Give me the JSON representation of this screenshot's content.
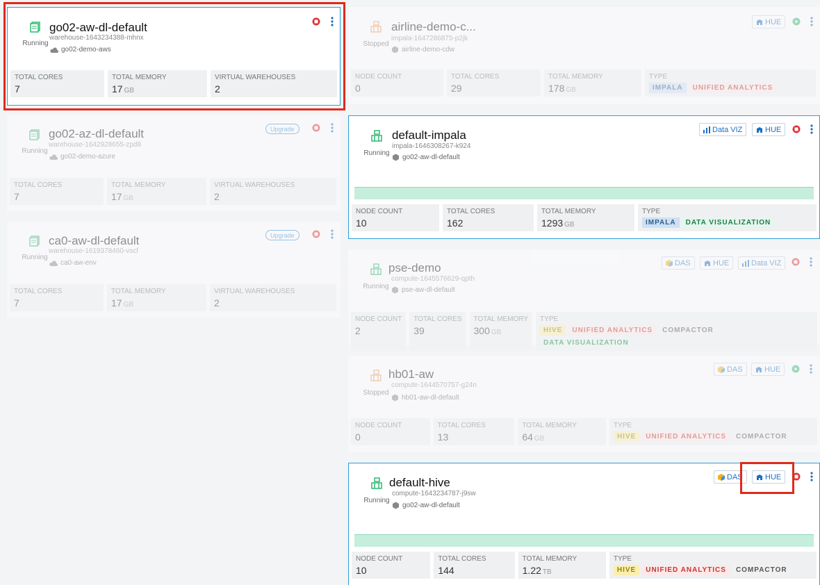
{
  "warehouses": [
    {
      "name": "go02-aw-dl-default",
      "id": "warehouse-1643234388-mhnx",
      "env": "go02-demo-aws",
      "status": "Running",
      "labels": {
        "cores": "TOTAL CORES",
        "memory": "TOTAL MEMORY",
        "vw": "VIRTUAL WAREHOUSES"
      },
      "cores": "7",
      "memory": "17",
      "memory_unit": "GB",
      "vws": "2"
    },
    {
      "name": "go02-az-dl-default",
      "id": "warehouse-1642928655-zpd8",
      "env": "go02-demo-azure",
      "status": "Running",
      "upgrade": "Upgrade",
      "labels": {
        "cores": "TOTAL CORES",
        "memory": "TOTAL MEMORY",
        "vw": "VIRTUAL WAREHOUSES"
      },
      "cores": "7",
      "memory": "17",
      "memory_unit": "GB",
      "vws": "2"
    },
    {
      "name": "ca0-aw-dl-default",
      "id": "warehouse-1619378460-vscf",
      "env": "ca0-aw-env",
      "status": "Running",
      "upgrade": "Upgrade",
      "labels": {
        "cores": "TOTAL CORES",
        "memory": "TOTAL MEMORY",
        "vw": "VIRTUAL WAREHOUSES"
      },
      "cores": "7",
      "memory": "17",
      "memory_unit": "GB",
      "vws": "2"
    }
  ],
  "vws": [
    {
      "name": "airline-demo-c...",
      "id": "impala-1647286875-p2jk",
      "env": "airline-demo-cdw",
      "status": "Stopped",
      "labels": {
        "nodes": "NODE COUNT",
        "cores": "TOTAL CORES",
        "memory": "TOTAL MEMORY",
        "type": "TYPE"
      },
      "nodes": "0",
      "cores": "29",
      "memory": "178",
      "memory_unit": "GB",
      "tags": [
        "IMPALA",
        "UNIFIED ANALYTICS"
      ],
      "hue": "HUE"
    },
    {
      "name": "default-impala",
      "id": "impala-1646308267-k924",
      "env": "go02-aw-dl-default",
      "status": "Running",
      "labels": {
        "nodes": "NODE COUNT",
        "cores": "TOTAL CORES",
        "memory": "TOTAL MEMORY",
        "type": "TYPE"
      },
      "nodes": "10",
      "cores": "162",
      "memory": "1293",
      "memory_unit": "GB",
      "tags": [
        "IMPALA",
        "DATA VISUALIZATION"
      ],
      "dataviz": "Data VIZ",
      "hue": "HUE"
    },
    {
      "name": "pse-demo",
      "id": "compute-1645576629-qpth",
      "env": "pse-aw-dl-default",
      "status": "Running",
      "labels": {
        "nodes": "NODE COUNT",
        "cores": "TOTAL CORES",
        "memory": "TOTAL MEMORY",
        "type": "TYPE"
      },
      "nodes": "2",
      "cores": "39",
      "memory": "300",
      "memory_unit": "GB",
      "tags": [
        "HIVE",
        "UNIFIED ANALYTICS",
        "COMPACTOR",
        "DATA VISUALIZATION"
      ],
      "das": "DAS",
      "hue": "HUE",
      "dataviz": "Data VIZ"
    },
    {
      "name": "hb01-aw",
      "id": "compute-1644570757-g24n",
      "env": "hb01-aw-dl-default",
      "status": "Stopped",
      "labels": {
        "nodes": "NODE COUNT",
        "cores": "TOTAL CORES",
        "memory": "TOTAL MEMORY",
        "type": "TYPE"
      },
      "nodes": "0",
      "cores": "13",
      "memory": "64",
      "memory_unit": "GB",
      "tags": [
        "HIVE",
        "UNIFIED ANALYTICS",
        "COMPACTOR"
      ],
      "das": "DAS",
      "hue": "HUE"
    },
    {
      "name": "default-hive",
      "id": "compute-1643234787-j9sw",
      "env": "go02-aw-dl-default",
      "status": "Running",
      "labels": {
        "nodes": "NODE COUNT",
        "cores": "TOTAL CORES",
        "memory": "TOTAL MEMORY",
        "type": "TYPE"
      },
      "nodes": "10",
      "cores": "144",
      "memory": "1.22",
      "memory_unit": "TB",
      "tags": [
        "HIVE",
        "UNIFIED ANALYTICS",
        "COMPACTOR"
      ],
      "das": "DAS",
      "hue": "HUE"
    }
  ],
  "colors": {
    "running": "#2eb872",
    "stopped": "#f0a060",
    "stop": "#e0303a",
    "start": "#3cb878",
    "link": "#1b6fc2",
    "highlight": "#e02a1a"
  },
  "icons": {
    "warehouse": "database-warehouse-icon",
    "vw": "virtual-warehouse-icon",
    "env": "cloud-icon",
    "hue": "hue-icon",
    "das": "das-icon",
    "dataviz": "bar-chart-icon",
    "stop": "stop-icon",
    "start": "play-icon",
    "menu": "kebab-menu-icon"
  }
}
